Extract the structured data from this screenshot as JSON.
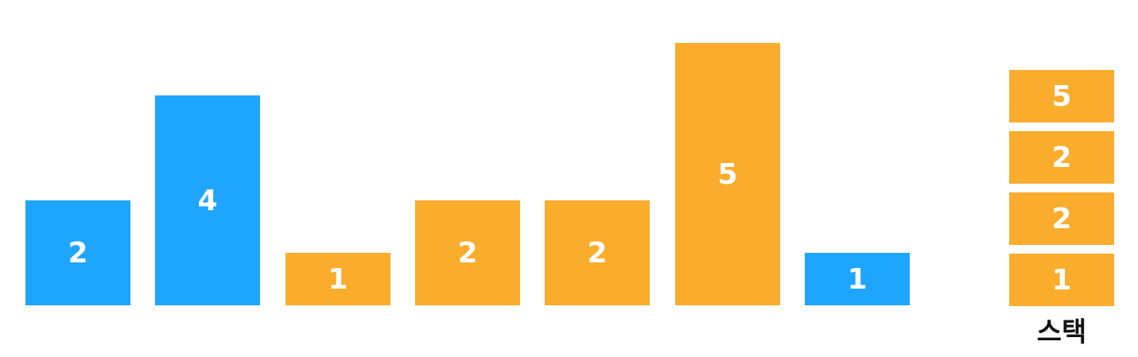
{
  "chart_data": {
    "type": "bar",
    "categories": [
      "",
      "",
      "",
      "",
      "",
      "",
      ""
    ],
    "values": [
      2,
      4,
      1,
      2,
      2,
      5,
      1
    ],
    "states": [
      "popped",
      "popped",
      "in-stack",
      "in-stack",
      "in-stack",
      "in-stack",
      "current"
    ]
  },
  "colors": {
    "blue": "#1EA5FF",
    "orange": "#FAAC2D"
  },
  "bars": [
    {
      "label": "2",
      "color": "blue"
    },
    {
      "label": "4",
      "color": "blue"
    },
    {
      "label": "1",
      "color": "orange"
    },
    {
      "label": "2",
      "color": "orange"
    },
    {
      "label": "2",
      "color": "orange"
    },
    {
      "label": "5",
      "color": "orange"
    },
    {
      "label": "1",
      "color": "blue"
    }
  ],
  "stack": {
    "items_top_to_bottom": [
      "5",
      "2",
      "2",
      "1"
    ],
    "label": "스택"
  }
}
